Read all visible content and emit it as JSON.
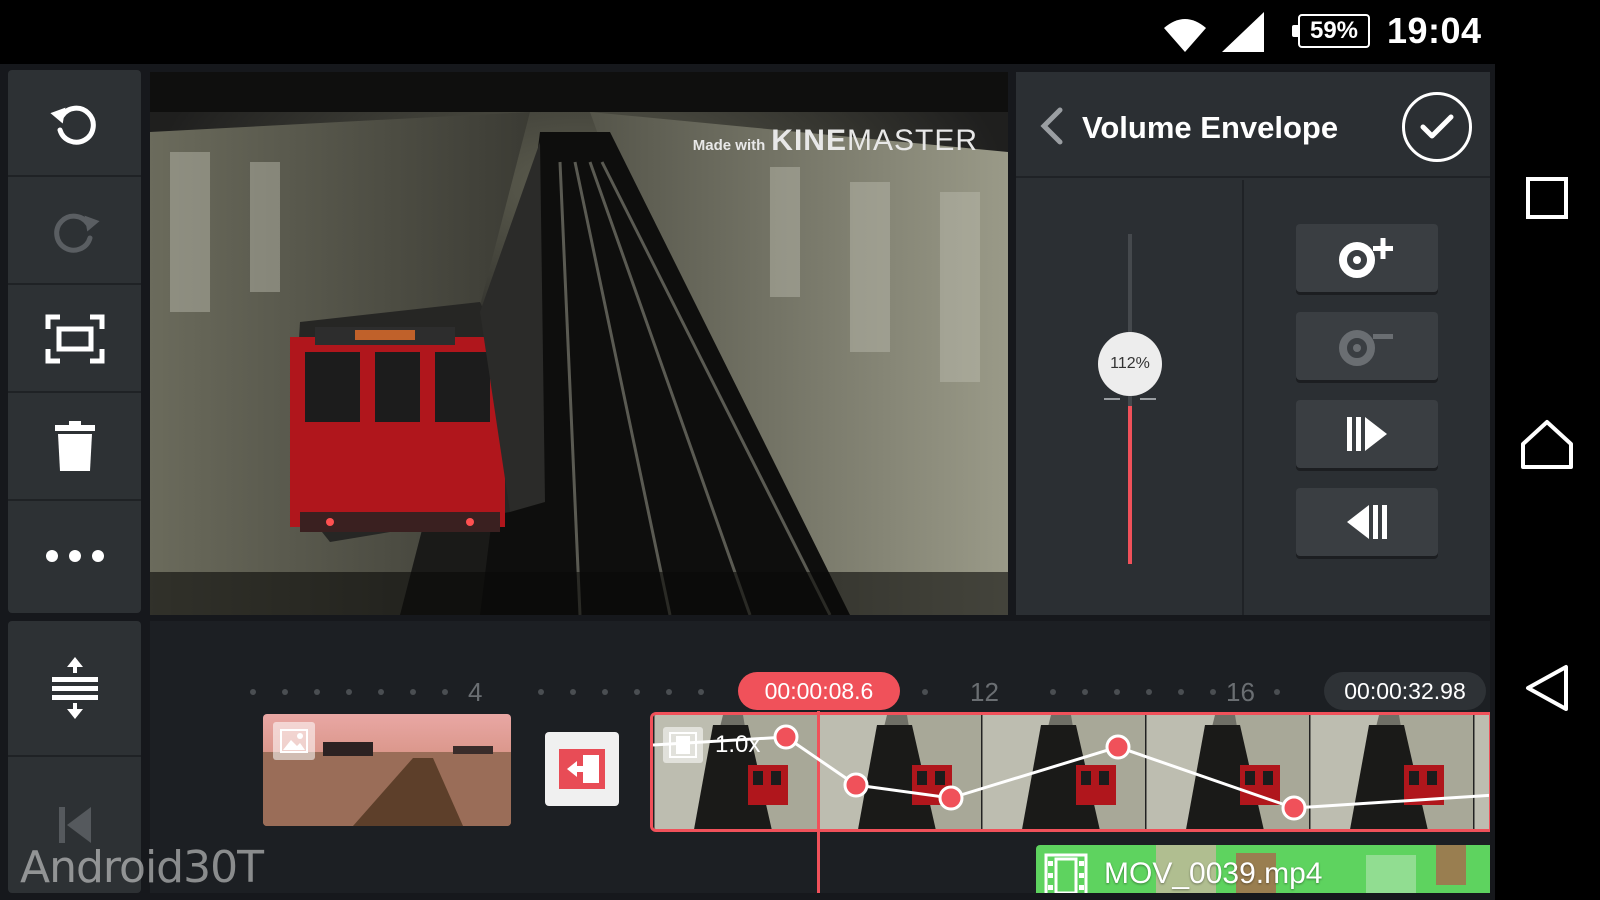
{
  "status_bar": {
    "battery": "59%",
    "time": "19:04"
  },
  "toolbar": {
    "items": [
      {
        "icon": "undo-icon"
      },
      {
        "icon": "redo-icon"
      },
      {
        "icon": "fullscreen-icon"
      },
      {
        "icon": "trash-icon"
      },
      {
        "icon": "more-icon"
      }
    ],
    "lower_items": [
      {
        "icon": "track-height-icon"
      },
      {
        "icon": "skip-to-start-icon"
      }
    ]
  },
  "preview": {
    "watermark_small": "Made with",
    "watermark_bold": "KINE",
    "watermark_light": "MASTER"
  },
  "panel": {
    "title": "Volume Envelope",
    "slider_value_label": "112%",
    "slider_level_fraction": 0.5,
    "buttons": [
      {
        "icon": "add-keypoint-icon"
      },
      {
        "icon": "remove-keypoint-icon"
      },
      {
        "icon": "next-keypoint-icon"
      },
      {
        "icon": "previous-keypoint-icon"
      }
    ]
  },
  "timeline": {
    "ruler_numbers": [
      "4",
      "12",
      "16"
    ],
    "current_time": "00:00:08.6",
    "total_time": "00:00:32.98",
    "video_clip_speed": "1.0x",
    "audio_clip_name": "MOV_0039.mp4"
  },
  "site_watermark": "Android30T",
  "colors": {
    "accent": "#f0515a",
    "audio_clip": "#5ed35f",
    "panel": "#2b2f33"
  }
}
